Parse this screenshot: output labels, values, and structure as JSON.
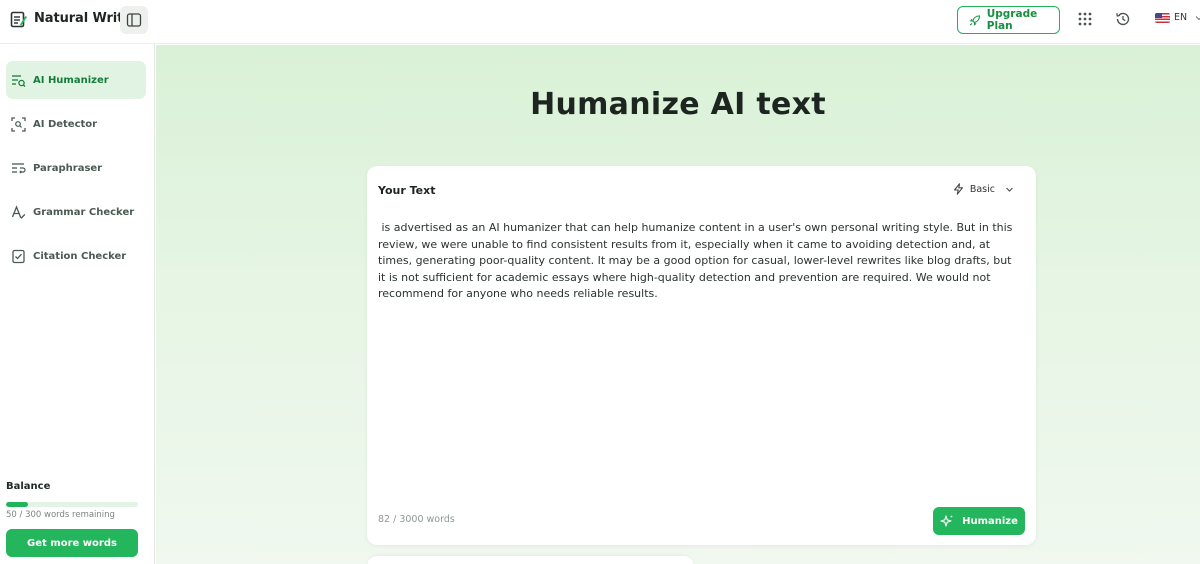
{
  "app": {
    "brand": "Natural Write"
  },
  "header": {
    "upgrade_label": "Upgrade Plan",
    "language": "EN"
  },
  "sidebar": {
    "items": [
      {
        "label": "AI Humanizer",
        "icon": "humanizer-icon",
        "active": true
      },
      {
        "label": "AI Detector",
        "icon": "detector-icon",
        "active": false
      },
      {
        "label": "Paraphraser",
        "icon": "paraphraser-icon",
        "active": false
      },
      {
        "label": "Grammar Checker",
        "icon": "grammar-icon",
        "active": false
      },
      {
        "label": "Citation Checker",
        "icon": "citation-icon",
        "active": false
      }
    ],
    "balance": {
      "title": "Balance",
      "used_fraction": 0.1667,
      "text": "50 / 300 words remaining",
      "button_label": "Get more words"
    }
  },
  "main": {
    "title": "Humanize AI text",
    "card": {
      "title": "Your Text",
      "mode": "Basic",
      "text": " is advertised as an AI humanizer that can help humanize content in a user's own personal writing style. But in this review, we were unable to find consistent results from it, especially when it came to avoiding detection and, at times, generating poor-quality content. It may be a good option for casual, lower-level rewrites like blog drafts, but it is not sufficient for academic essays where high-quality detection and prevention are required. We would not recommend for anyone who needs reliable results.",
      "word_count": "82 / 3000 words",
      "humanize_label": "Humanize"
    }
  },
  "colors": {
    "accent": "#23b65c",
    "active_bg": "#e1f4e3"
  }
}
